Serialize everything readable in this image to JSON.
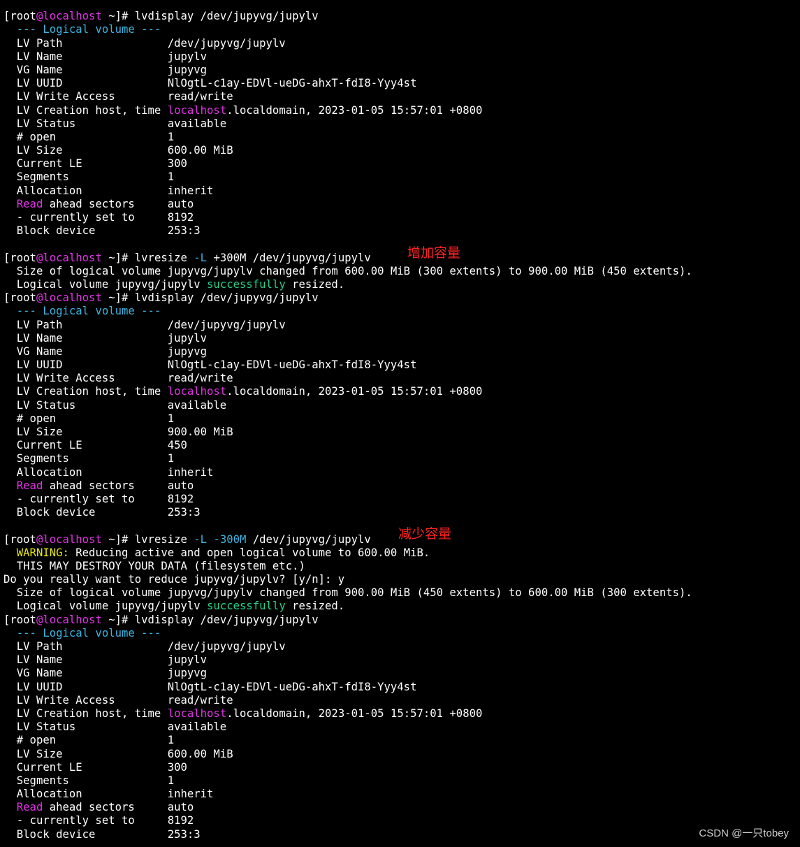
{
  "colors": {
    "background": "#000000",
    "default": "#ffffff",
    "magenta": "#e233e6",
    "cyan": "#3fb4e0",
    "green": "#23d18b",
    "yellow": "#e5e510",
    "annotation": "#ff2222"
  },
  "terminal": {
    "lines": [
      [
        {
          "t": "  "
        }
      ],
      [
        {
          "t": "[root"
        },
        {
          "t": "@localhost",
          "c": "magenta"
        },
        {
          "t": " ~]# lvdisplay /dev/jupyvg/jupylv"
        }
      ],
      [
        {
          "t": "  --- Logical volume ---",
          "c": "cyan"
        }
      ],
      [
        {
          "t": "  LV Path                /dev/jupyvg/jupylv"
        }
      ],
      [
        {
          "t": "  LV Name                jupylv"
        }
      ],
      [
        {
          "t": "  VG Name                jupyvg"
        }
      ],
      [
        {
          "t": "  LV UUID                NlOgtL-c1ay-EDVl-ueDG-ahxT-fdI8-Yyy4st"
        }
      ],
      [
        {
          "t": "  LV Write Access        read/write"
        }
      ],
      [
        {
          "t": "  LV Creation host, time "
        },
        {
          "t": "localhost",
          "c": "magenta"
        },
        {
          "t": ".localdomain, 2023-01-05 15:57:01 +0800"
        }
      ],
      [
        {
          "t": "  LV Status              available"
        }
      ],
      [
        {
          "t": "  # open                 1"
        }
      ],
      [
        {
          "t": "  LV Size                600.00 MiB"
        }
      ],
      [
        {
          "t": "  Current LE             300"
        }
      ],
      [
        {
          "t": "  Segments               1"
        }
      ],
      [
        {
          "t": "  Allocation             inherit"
        }
      ],
      [
        {
          "t": "  "
        },
        {
          "t": "Read",
          "c": "magenta"
        },
        {
          "t": " ahead sectors     auto"
        }
      ],
      [
        {
          "t": "  - currently set to     8192"
        }
      ],
      [
        {
          "t": "  Block device           253:3"
        }
      ],
      [
        {
          "t": " "
        }
      ],
      [
        {
          "t": "[root"
        },
        {
          "t": "@localhost",
          "c": "magenta"
        },
        {
          "t": " ~]# lvresize "
        },
        {
          "t": "-L",
          "c": "cyan"
        },
        {
          "t": " +300M /dev/jupyvg/jupylv"
        }
      ],
      [
        {
          "t": "  Size of logical volume jupyvg/jupylv changed from 600.00 MiB (300 extents) to 900.00 MiB (450 extents)."
        }
      ],
      [
        {
          "t": "  Logical volume jupyvg/jupylv "
        },
        {
          "t": "successfully",
          "c": "green"
        },
        {
          "t": " resized."
        }
      ],
      [
        {
          "t": "[root"
        },
        {
          "t": "@localhost",
          "c": "magenta"
        },
        {
          "t": " ~]# lvdisplay /dev/jupyvg/jupylv"
        }
      ],
      [
        {
          "t": "  --- Logical volume ---",
          "c": "cyan"
        }
      ],
      [
        {
          "t": "  LV Path                /dev/jupyvg/jupylv"
        }
      ],
      [
        {
          "t": "  LV Name                jupylv"
        }
      ],
      [
        {
          "t": "  VG Name                jupyvg"
        }
      ],
      [
        {
          "t": "  LV UUID                NlOgtL-c1ay-EDVl-ueDG-ahxT-fdI8-Yyy4st"
        }
      ],
      [
        {
          "t": "  LV Write Access        read/write"
        }
      ],
      [
        {
          "t": "  LV Creation host, time "
        },
        {
          "t": "localhost",
          "c": "magenta"
        },
        {
          "t": ".localdomain, 2023-01-05 15:57:01 +0800"
        }
      ],
      [
        {
          "t": "  LV Status              available"
        }
      ],
      [
        {
          "t": "  # open                 1"
        }
      ],
      [
        {
          "t": "  LV Size                900.00 MiB"
        }
      ],
      [
        {
          "t": "  Current LE             450"
        }
      ],
      [
        {
          "t": "  Segments               1"
        }
      ],
      [
        {
          "t": "  Allocation             inherit"
        }
      ],
      [
        {
          "t": "  "
        },
        {
          "t": "Read",
          "c": "magenta"
        },
        {
          "t": " ahead sectors     auto"
        }
      ],
      [
        {
          "t": "  - currently set to     8192"
        }
      ],
      [
        {
          "t": "  Block device           253:3"
        }
      ],
      [
        {
          "t": " "
        }
      ],
      [
        {
          "t": "[root"
        },
        {
          "t": "@localhost",
          "c": "magenta"
        },
        {
          "t": " ~]# lvresize "
        },
        {
          "t": "-L -300M",
          "c": "cyan"
        },
        {
          "t": " /dev/jupyvg/jupylv"
        }
      ],
      [
        {
          "t": "  "
        },
        {
          "t": "WARNING:",
          "c": "yellow"
        },
        {
          "t": " Reducing active and open logical volume to 600.00 MiB."
        }
      ],
      [
        {
          "t": "  THIS MAY DESTROY YOUR DATA (filesystem etc.)"
        }
      ],
      [
        {
          "t": "Do you really want to reduce jupyvg/jupylv? [y/n]: y"
        }
      ],
      [
        {
          "t": "  Size of logical volume jupyvg/jupylv changed from 900.00 MiB (450 extents) to 600.00 MiB (300 extents)."
        }
      ],
      [
        {
          "t": "  Logical volume jupyvg/jupylv "
        },
        {
          "t": "successfully",
          "c": "green"
        },
        {
          "t": " resized."
        }
      ],
      [
        {
          "t": "[root"
        },
        {
          "t": "@localhost",
          "c": "magenta"
        },
        {
          "t": " ~]# lvdisplay /dev/jupyvg/jupylv"
        }
      ],
      [
        {
          "t": "  --- Logical volume ---",
          "c": "cyan"
        }
      ],
      [
        {
          "t": "  LV Path                /dev/jupyvg/jupylv"
        }
      ],
      [
        {
          "t": "  LV Name                jupylv"
        }
      ],
      [
        {
          "t": "  VG Name                jupyvg"
        }
      ],
      [
        {
          "t": "  LV UUID                NlOgtL-c1ay-EDVl-ueDG-ahxT-fdI8-Yyy4st"
        }
      ],
      [
        {
          "t": "  LV Write Access        read/write"
        }
      ],
      [
        {
          "t": "  LV Creation host, time "
        },
        {
          "t": "localhost",
          "c": "magenta"
        },
        {
          "t": ".localdomain, 2023-01-05 15:57:01 +0800"
        }
      ],
      [
        {
          "t": "  LV Status              available"
        }
      ],
      [
        {
          "t": "  # open                 1"
        }
      ],
      [
        {
          "t": "  LV Size                600.00 MiB"
        }
      ],
      [
        {
          "t": "  Current LE             300"
        }
      ],
      [
        {
          "t": "  Segments               1"
        }
      ],
      [
        {
          "t": "  Allocation             inherit"
        }
      ],
      [
        {
          "t": "  "
        },
        {
          "t": "Read",
          "c": "magenta"
        },
        {
          "t": " ahead sectors     auto"
        }
      ],
      [
        {
          "t": "  - currently set to     8192"
        }
      ],
      [
        {
          "t": "  Block device           253:3"
        }
      ]
    ]
  },
  "annotations": {
    "increase": "增加容量",
    "decrease": "减少容量"
  },
  "watermark": "CSDN @一只tobey"
}
